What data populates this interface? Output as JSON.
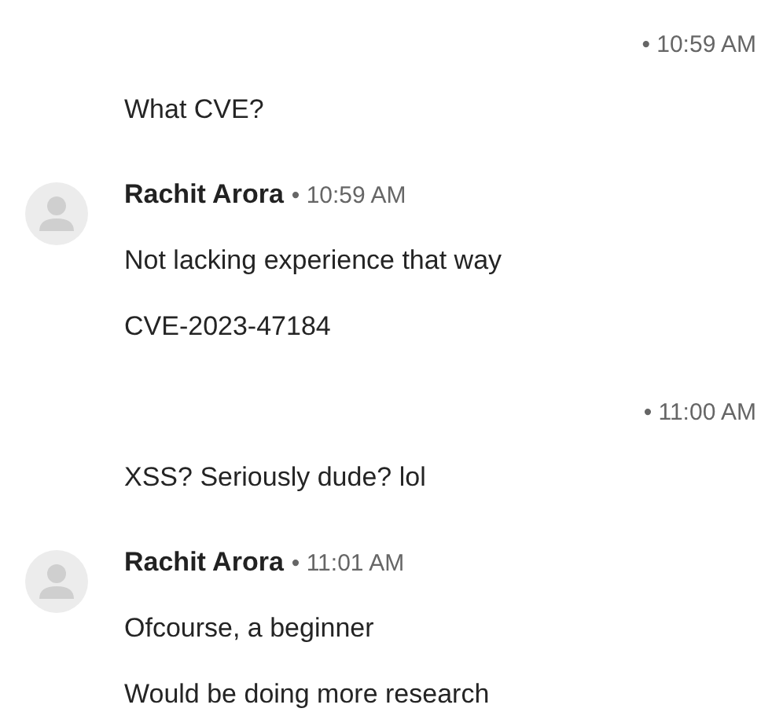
{
  "groups": [
    {
      "kind": "own",
      "time": "• 10:59 AM",
      "messages": [
        "What CVE?"
      ]
    },
    {
      "kind": "other",
      "sender": "Rachit Arora",
      "time": "• 10:59 AM",
      "messages": [
        "Not lacking experience that way",
        "CVE-2023-47184"
      ]
    },
    {
      "kind": "own",
      "time": "• 11:00 AM",
      "messages": [
        "XSS? Seriously dude? lol"
      ]
    },
    {
      "kind": "other",
      "sender": "Rachit Arora",
      "time": "• 11:01 AM",
      "messages": [
        "Ofcourse, a beginner",
        "Would be doing more research"
      ]
    }
  ]
}
